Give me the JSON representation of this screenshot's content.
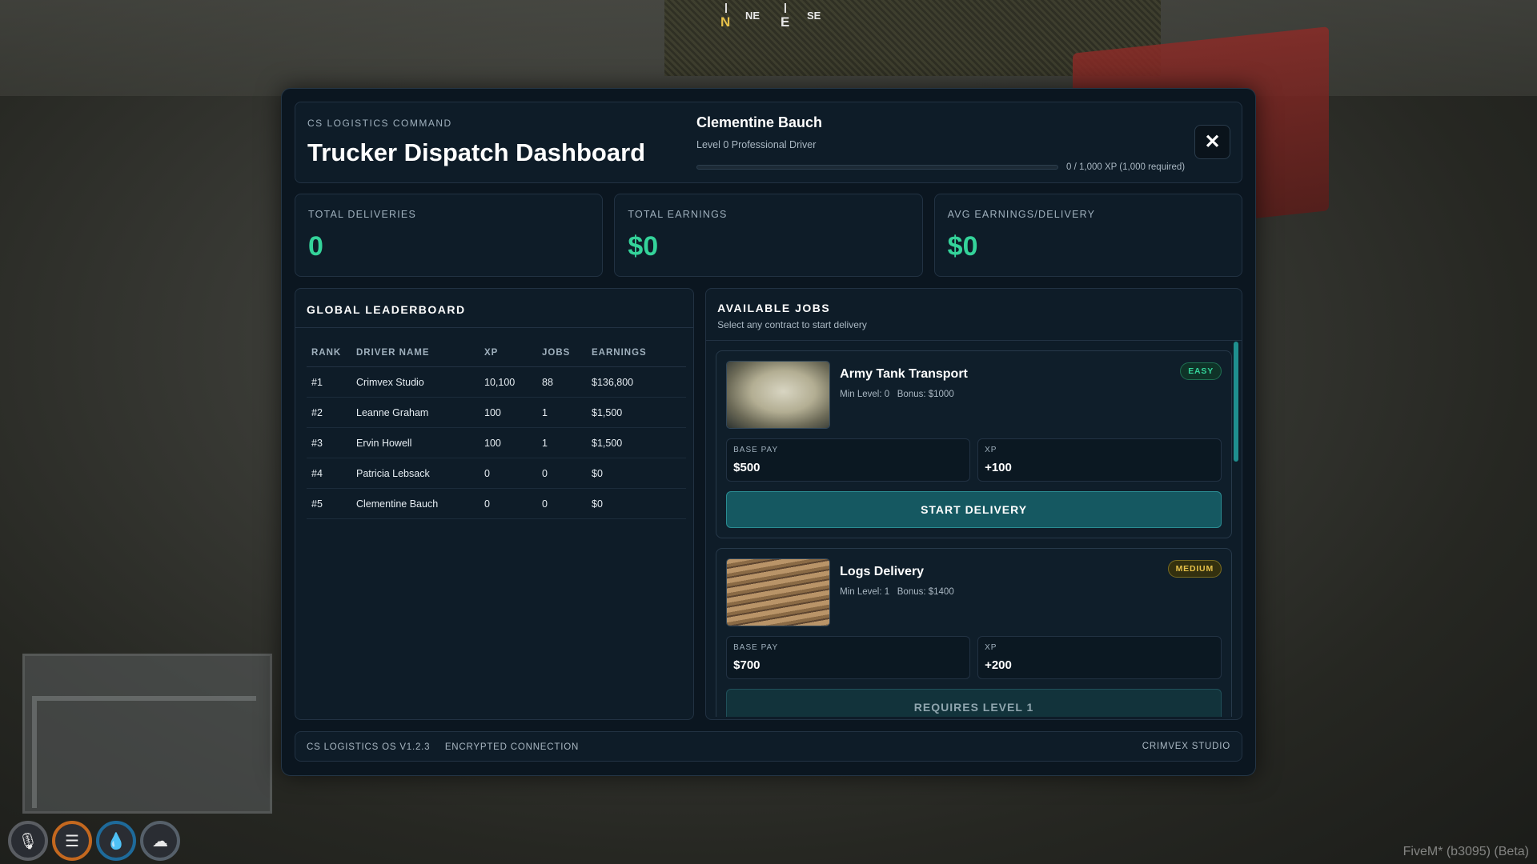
{
  "hud": {
    "compass": {
      "n": "N",
      "ne": "NE",
      "e": "E",
      "se": "SE"
    },
    "icons": [
      "microphone-icon",
      "food-icon",
      "water-drop-icon",
      "lungs-icon"
    ],
    "watermark": "FiveM* (b3095) (Beta)"
  },
  "header": {
    "subtitle": "CS LOGISTICS COMMAND",
    "title": "Trucker Dispatch Dashboard",
    "driver_name": "Clementine Bauch",
    "driver_level": "Level 0 Professional Driver",
    "xp_progress": 0,
    "xp_text": "0 / 1,000 XP (1,000 required)",
    "close_label": "✕"
  },
  "stats": [
    {
      "label": "TOTAL DELIVERIES",
      "value": "0"
    },
    {
      "label": "TOTAL EARNINGS",
      "value": "$0"
    },
    {
      "label": "AVG EARNINGS/DELIVERY",
      "value": "$0"
    }
  ],
  "leaderboard": {
    "title": "GLOBAL LEADERBOARD",
    "columns": [
      "RANK",
      "DRIVER NAME",
      "XP",
      "JOBS",
      "EARNINGS"
    ],
    "rows": [
      [
        "#1",
        "Crimvex Studio",
        "10,100",
        "88",
        "$136,800"
      ],
      [
        "#2",
        "Leanne Graham",
        "100",
        "1",
        "$1,500"
      ],
      [
        "#3",
        "Ervin Howell",
        "100",
        "1",
        "$1,500"
      ],
      [
        "#4",
        "Patricia Lebsack",
        "0",
        "0",
        "$0"
      ],
      [
        "#5",
        "Clementine Bauch",
        "0",
        "0",
        "$0"
      ]
    ]
  },
  "jobs": {
    "title": "AVAILABLE JOBS",
    "subtitle": "Select any contract to start delivery",
    "items": [
      {
        "name": "Army Tank Transport",
        "min_level": "Min Level: 0",
        "bonus": "Bonus: $1000",
        "difficulty": "EASY",
        "base_pay_label": "BASE PAY",
        "base_pay": "$500",
        "xp_label": "XP",
        "xp": "+100",
        "action": "START DELIVERY"
      },
      {
        "name": "Logs Delivery",
        "min_level": "Min Level: 1",
        "bonus": "Bonus: $1400",
        "difficulty": "MEDIUM",
        "base_pay_label": "BASE PAY",
        "base_pay": "$700",
        "xp_label": "XP",
        "xp": "+200",
        "action": "REQUIRES LEVEL 1"
      }
    ]
  },
  "footer": {
    "version": "CS LOGISTICS OS V1.2.3",
    "connection": "ENCRYPTED CONNECTION",
    "studio": "CRIMVEX STUDIO"
  },
  "colors": {
    "accent": "#34d39a",
    "panel": "#0b1620",
    "button": "#155861",
    "medium": "#e6c14a"
  }
}
